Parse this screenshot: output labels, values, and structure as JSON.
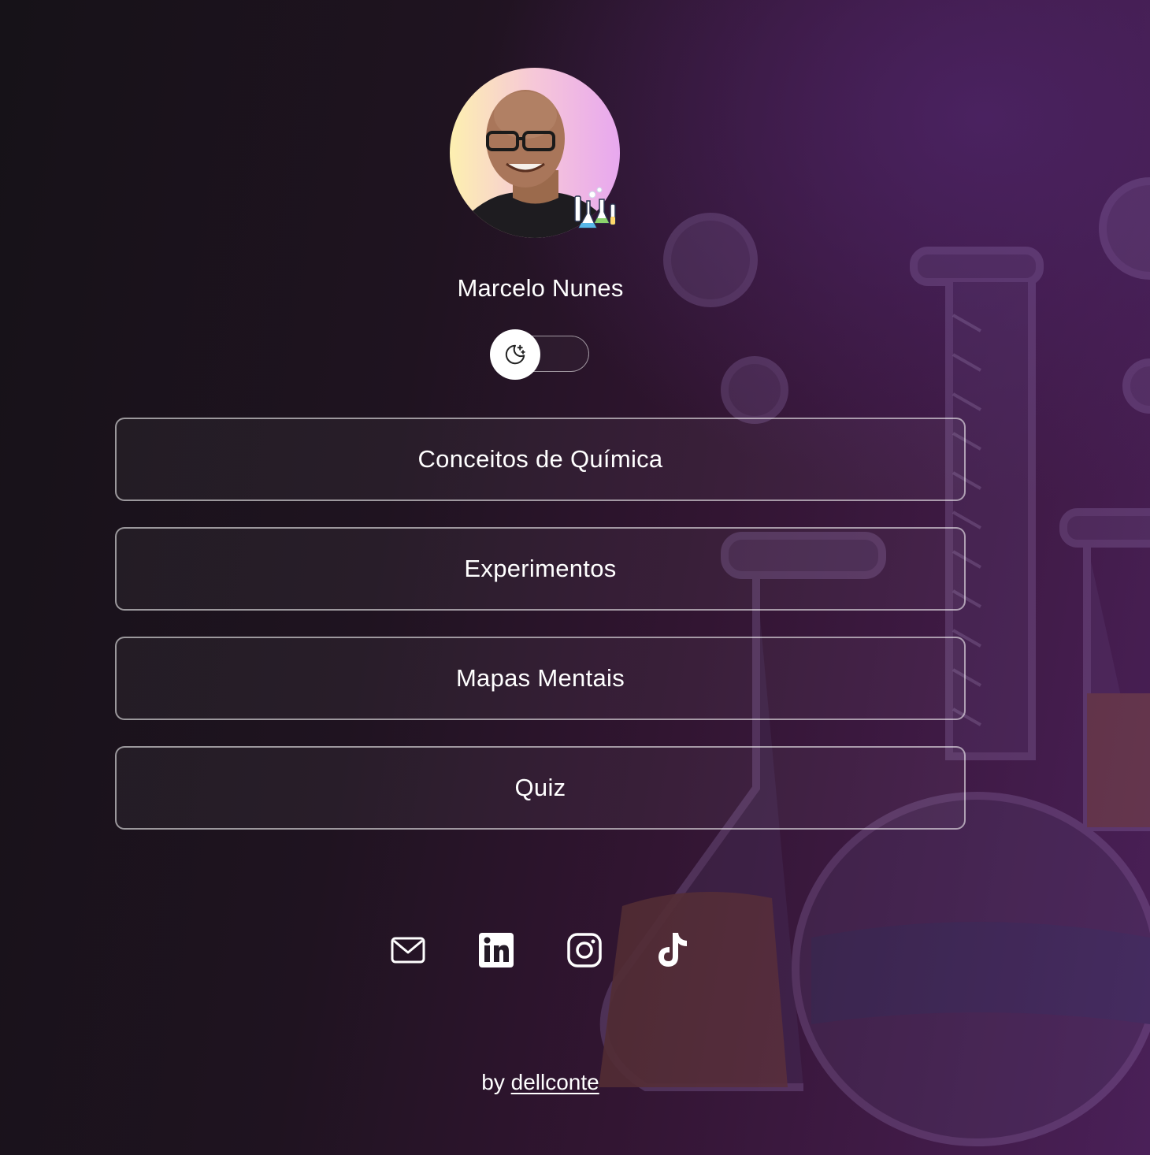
{
  "profile": {
    "name": "Marcelo Nunes",
    "avatar": "profile-photo",
    "badge_icon": "lab-flasks-icon"
  },
  "theme_toggle": {
    "icon": "moon-stars-icon",
    "state": "dark"
  },
  "links": [
    {
      "label": "Conceitos de Química"
    },
    {
      "label": "Experimentos"
    },
    {
      "label": "Mapas Mentais"
    },
    {
      "label": "Quiz"
    }
  ],
  "socials": [
    {
      "icon": "mail-icon"
    },
    {
      "icon": "linkedin-icon"
    },
    {
      "icon": "instagram-icon"
    },
    {
      "icon": "tiktok-icon"
    }
  ],
  "footer": {
    "prefix": "by",
    "author": "dellconte"
  },
  "colors": {
    "background_dark": "#161218",
    "background_purple": "#4a2058",
    "text": "#ffffff",
    "button_border": "#8c8c8c"
  }
}
